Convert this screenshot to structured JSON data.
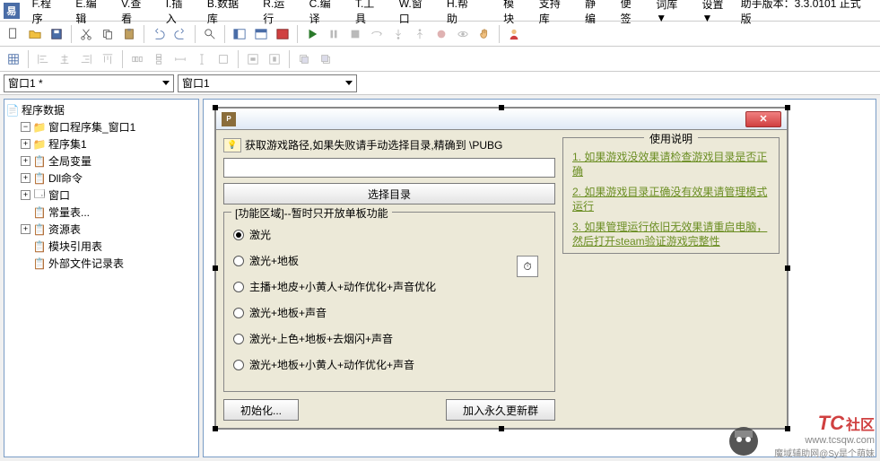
{
  "menu": {
    "items": [
      "F.程序",
      "E.编辑",
      "V.查看",
      "I.插入",
      "B.数据库",
      "R.运行",
      "C.编译",
      "T.工具",
      "W.窗口",
      "H.帮助"
    ],
    "extras": [
      "模块",
      "支持库",
      "静编",
      "便签",
      "词库▼",
      "设置▼"
    ],
    "version_label": "助手版本：3.3.0101 正式版"
  },
  "combos": {
    "left": "窗口1 *",
    "right": "窗口1"
  },
  "tree": {
    "title": "程序数据",
    "root": "程序数据",
    "nodes": [
      {
        "label": "窗口程序集_窗口1",
        "ex": "-"
      },
      {
        "label": "程序集1",
        "ex": "+"
      },
      {
        "label": "全局变量",
        "ex": "+"
      },
      {
        "label": "Dll命令",
        "ex": "+"
      },
      {
        "label": "窗口",
        "ex": "+"
      },
      {
        "label": "常量表...",
        "ex": ""
      },
      {
        "label": "资源表",
        "ex": "+"
      },
      {
        "label": "模块引用表",
        "ex": ""
      },
      {
        "label": "外部文件记录表",
        "ex": ""
      }
    ]
  },
  "window": {
    "titlebar_icon": "PUBG",
    "hint": "获取游戏路径,如果失败请手动选择目录,精确到 \\PUBG",
    "select_btn": "选择目录",
    "group_label": "[功能区域]--暂时只开放单板功能",
    "radios": [
      "激光",
      "激光+地板",
      "主播+地皮+小黄人+动作优化+声音优化",
      "激光+地板+声音",
      "激光+上色+地板+去烟闪+声音",
      "激光+地板+小黄人+动作优化+声音"
    ],
    "init_btn": "初始化...",
    "join_btn": "加入永久更新群",
    "usage_title": "使用说明",
    "usage": [
      "1. 如果游戏没效果请检查游戏目录是否正确",
      "2. 如果游戏目录正确没有效果请管理模式运行",
      "3. 如果管理运行依旧无效果请重启电脑，然后打开steam验证游戏完整性"
    ]
  },
  "watermark": {
    "main": "TC",
    "sub": "社区",
    "url": "www.tcsqw.com",
    "credit": "魔域辅助网@Sy是个萌妹"
  }
}
